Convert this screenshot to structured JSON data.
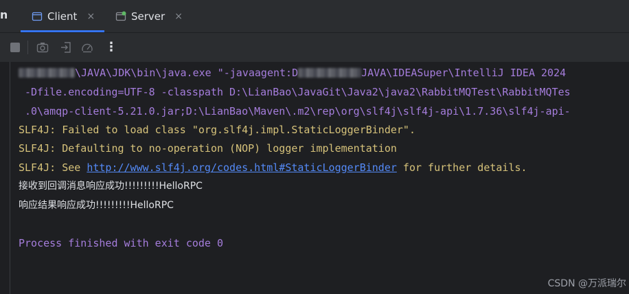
{
  "tabs": {
    "edge_label": "n",
    "items": [
      {
        "label": "Client",
        "active": true
      },
      {
        "label": "Server",
        "active": false
      }
    ],
    "close_glyph": "×"
  },
  "toolbar": {
    "more_glyph": "⋮"
  },
  "console": {
    "cmd1_a": "\\JAVA\\JDK\\bin\\java.exe \"-javaagent:D",
    "cmd1_b": "JAVA\\IDEASuper\\IntelliJ IDEA 2024",
    "cmd2": "-Dfile.encoding=UTF-8 -classpath D:\\LianBao\\JavaGit\\Java2\\java2\\RabbitMQTest\\RabbitMQTes",
    "cmd3": ".0\\amqp-client-5.21.0.jar;D:\\LianBao\\Maven\\.m2\\rep\\org\\slf4j\\slf4j-api\\1.7.36\\slf4j-api-",
    "warn1": "SLF4J: Failed to load class \"org.slf4j.impl.StaticLoggerBinder\".",
    "warn2": "SLF4J: Defaulting to no-operation (NOP) logger implementation",
    "warn3_prefix": "SLF4J: See ",
    "warn3_link": "http://www.slf4j.org/codes.html#StaticLoggerBinder",
    "warn3_suffix": " for further details.",
    "out1": "接收到回调消息响应成功!!!!!!!!!HelloRPC",
    "out2": "响应结果响应成功!!!!!!!!!HelloRPC",
    "exit": "Process finished with exit code 0"
  },
  "watermark": "CSDN @万派瑞尔",
  "colors": {
    "accent": "#3574f0",
    "command": "#a57ddc",
    "warning": "#d6c27a",
    "link": "#548af7"
  }
}
